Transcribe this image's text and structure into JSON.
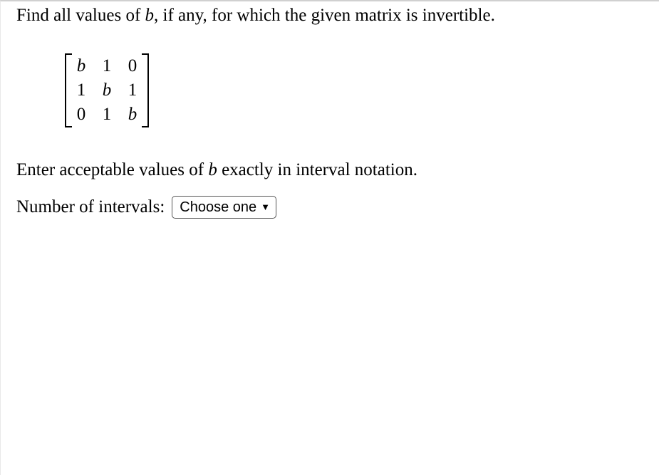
{
  "question": {
    "prefix": "Find all values of ",
    "var1": "b",
    "suffix": ", if any, for which the given matrix is invertible."
  },
  "matrix": {
    "rows": [
      [
        "b",
        "1",
        "0"
      ],
      [
        "1",
        "b",
        "1"
      ],
      [
        "0",
        "1",
        "b"
      ]
    ]
  },
  "instruction": {
    "prefix": "Enter acceptable values of ",
    "var": "b",
    "suffix": " exactly in interval notation."
  },
  "inputRow": {
    "label": "Number of intervals:",
    "dropdown": {
      "selected": "Choose one"
    }
  }
}
